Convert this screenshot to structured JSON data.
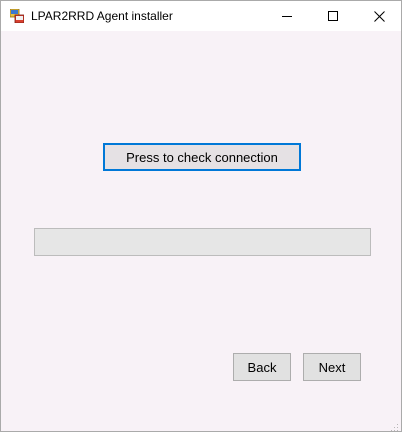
{
  "window": {
    "title": "LPAR2RRD Agent installer"
  },
  "controls": {
    "minimize_icon": "minimize-icon",
    "maximize_icon": "maximize-icon",
    "close_icon": "close-icon"
  },
  "main": {
    "check_connection_label": "Press to check connection",
    "progress_fraction": 0
  },
  "footer": {
    "back_label": "Back",
    "next_label": "Next"
  },
  "colors": {
    "window_bg": "#f8f2f7",
    "focus_border": "#0078d7",
    "button_bg": "#e1e1e1",
    "progress_bg": "#e6e6e6"
  }
}
